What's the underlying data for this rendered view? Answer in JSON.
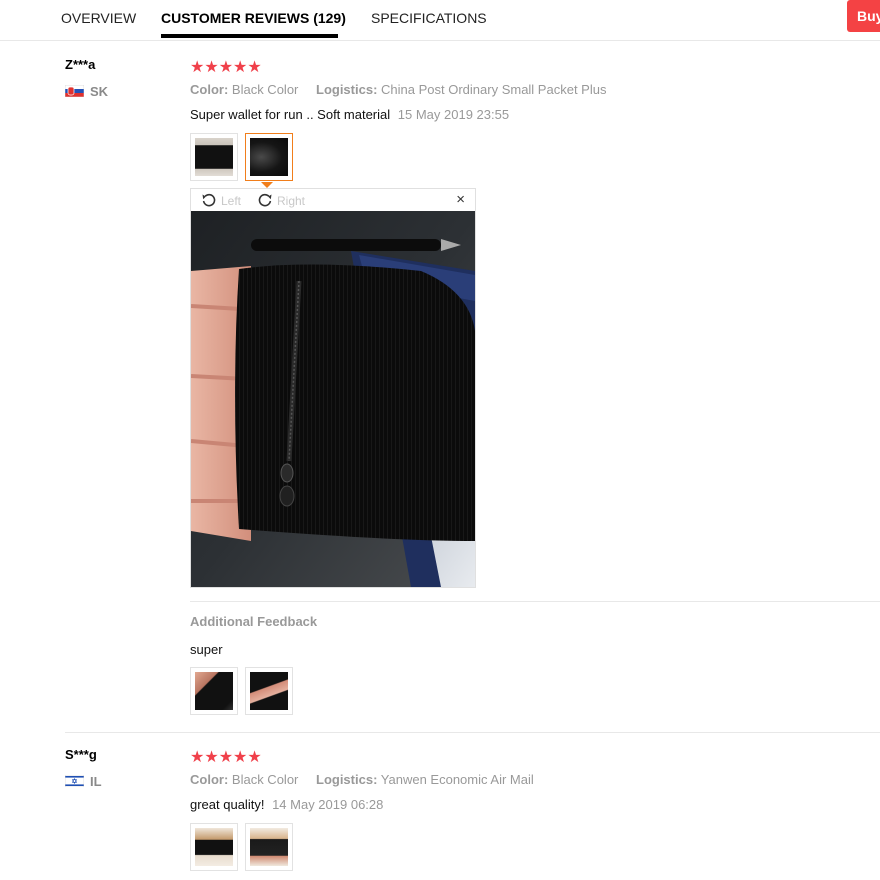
{
  "tabs": [
    {
      "label": "OVERVIEW",
      "active": false
    },
    {
      "label": "CUSTOMER REVIEWS (129)",
      "active": true
    },
    {
      "label": "SPECIFICATIONS",
      "active": false
    }
  ],
  "buy_button": {
    "label": "Buy"
  },
  "reviews": [
    {
      "name": "Z***a",
      "country": "SK",
      "rating": 5,
      "stars": "★★★★★",
      "color_label": "Color:",
      "color_value": "Black Color",
      "logistics_label": "Logistics:",
      "logistics_value": "China Post Ordinary Small Packet Plus",
      "text": "Super wallet for run .. Soft material",
      "date": "15 May 2019 23:55",
      "viewer": {
        "left_label": "Left",
        "right_label": "Right",
        "close_icon": "×"
      },
      "additional_feedback": {
        "label": "Additional Feedback",
        "text": "super"
      }
    },
    {
      "name": "S***g",
      "country": "IL",
      "rating": 5,
      "stars": "★★★★★",
      "color_label": "Color:",
      "color_value": "Black Color",
      "logistics_label": "Logistics:",
      "logistics_value": "Yanwen Economic Air Mail",
      "text": "great quality!",
      "date": "14 May 2019 06:28"
    }
  ],
  "colors": {
    "star": "#f0404a",
    "selected_thumb": "#f17e1b",
    "buy": "#f44244"
  }
}
